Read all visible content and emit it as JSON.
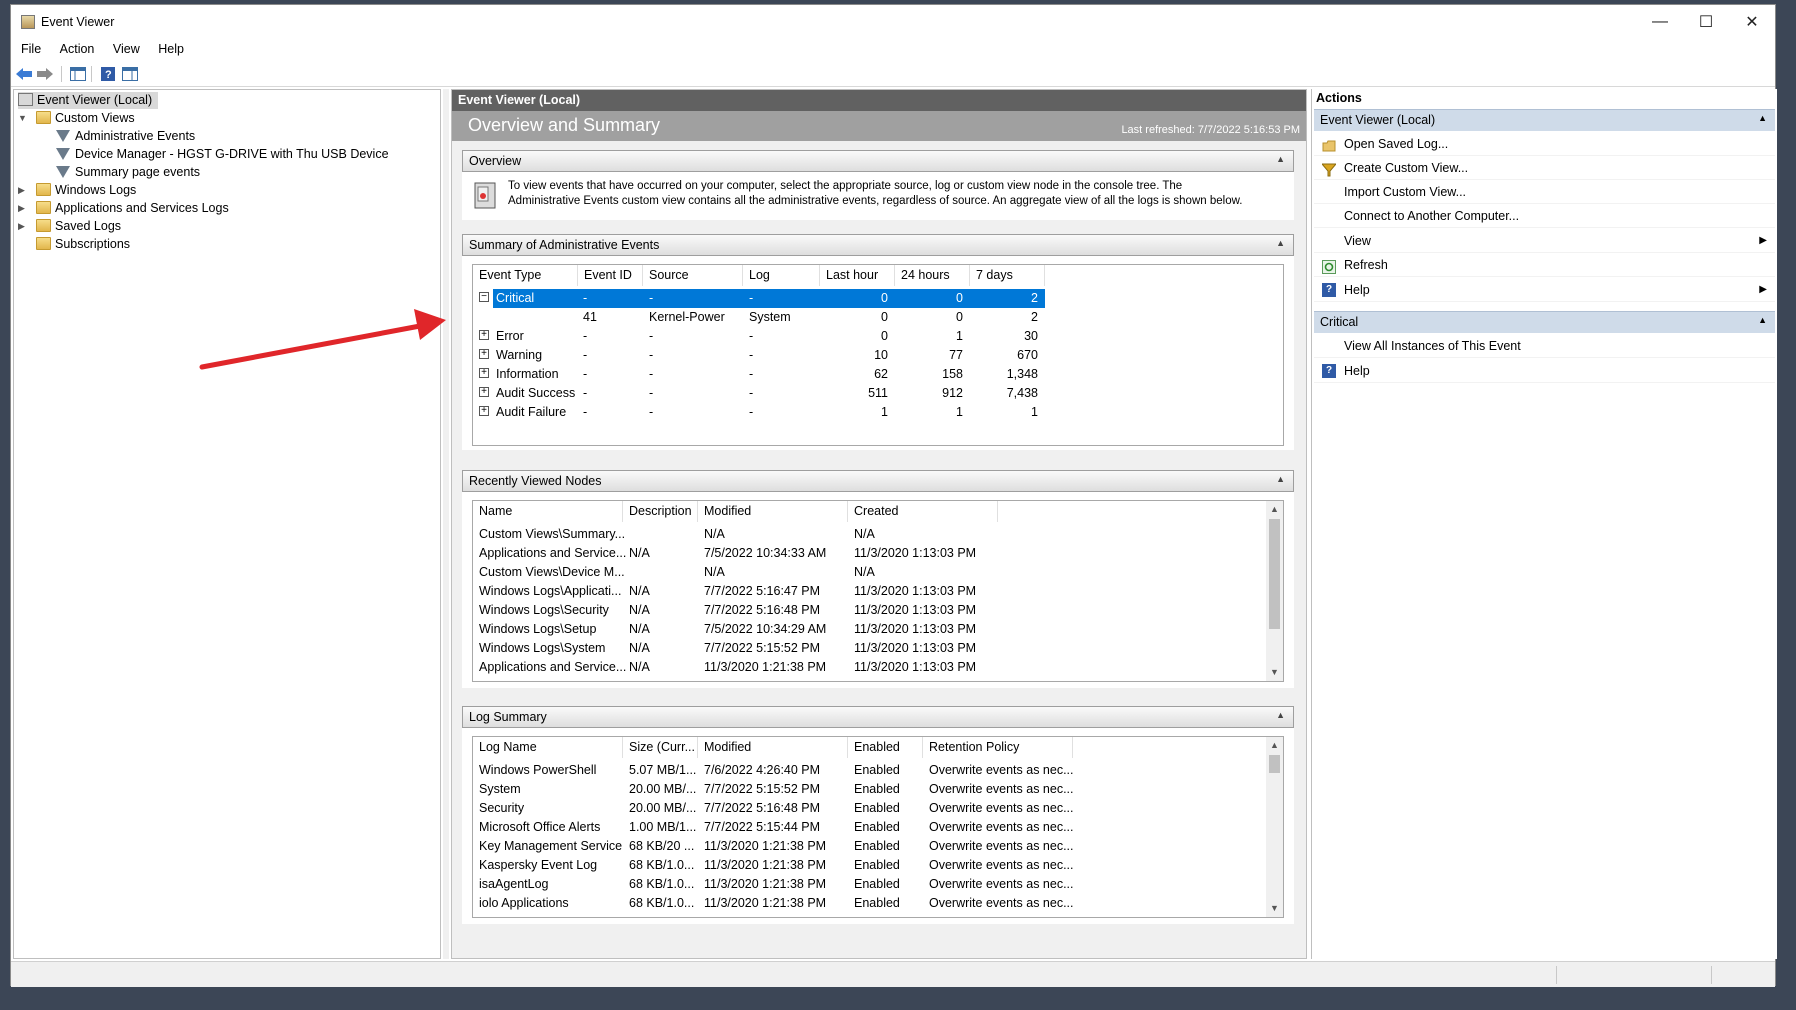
{
  "window": {
    "title": "Event Viewer",
    "minimize": "—",
    "maximize": "☐",
    "close": "✕"
  },
  "menu": [
    "File",
    "Action",
    "View",
    "Help"
  ],
  "toolbar_icons": [
    "back-arrow-icon",
    "forward-arrow-icon",
    "show-hide-console-tree-icon",
    "help-icon",
    "show-hide-action-pane-icon"
  ],
  "tree": {
    "root": "Event Viewer (Local)",
    "custom_views": "Custom Views",
    "custom_children": [
      "Administrative Events",
      "Device Manager - HGST G-DRIVE with Thu USB Device",
      "Summary page events"
    ],
    "windows_logs": "Windows Logs",
    "app_services_logs": "Applications and Services Logs",
    "saved_logs": "Saved Logs",
    "subscriptions": "Subscriptions"
  },
  "center": {
    "header": "Event Viewer (Local)",
    "banner_title": "Overview and Summary",
    "last_refreshed": "Last refreshed: 7/7/2022 5:16:53 PM",
    "overview": {
      "title": "Overview",
      "text_line1": "To view events that have occurred on your computer, select the appropriate source, log or custom view node in the console tree. The",
      "text_line2": "Administrative Events custom view contains all the administrative events, regardless of source. An aggregate view of all the logs is shown below."
    },
    "summary": {
      "title": "Summary of Administrative Events",
      "columns": [
        "Event Type",
        "Event ID",
        "Source",
        "Log",
        "Last hour",
        "24 hours",
        "7 days"
      ],
      "rows": [
        {
          "type": "Critical",
          "id": "-",
          "source": "-",
          "log": "-",
          "hour": "0",
          "day": "0",
          "week": "2",
          "expand": "−"
        },
        {
          "type": "",
          "id": "41",
          "source": "Kernel-Power",
          "log": "System",
          "hour": "0",
          "day": "0",
          "week": "2",
          "expand": ""
        },
        {
          "type": "Error",
          "id": "-",
          "source": "-",
          "log": "-",
          "hour": "0",
          "day": "1",
          "week": "30",
          "expand": "+"
        },
        {
          "type": "Warning",
          "id": "-",
          "source": "-",
          "log": "-",
          "hour": "10",
          "day": "77",
          "week": "670",
          "expand": "+"
        },
        {
          "type": "Information",
          "id": "-",
          "source": "-",
          "log": "-",
          "hour": "62",
          "day": "158",
          "week": "1,348",
          "expand": "+"
        },
        {
          "type": "Audit Success",
          "id": "-",
          "source": "-",
          "log": "-",
          "hour": "511",
          "day": "912",
          "week": "7,438",
          "expand": "+"
        },
        {
          "type": "Audit Failure",
          "id": "-",
          "source": "-",
          "log": "-",
          "hour": "1",
          "day": "1",
          "week": "1",
          "expand": "+"
        }
      ]
    },
    "recent": {
      "title": "Recently Viewed Nodes",
      "columns": [
        "Name",
        "Description",
        "Modified",
        "Created"
      ],
      "rows": [
        [
          "Custom Views\\Summary...",
          "",
          "N/A",
          "N/A"
        ],
        [
          "Applications and Service...",
          "N/A",
          "7/5/2022 10:34:33 AM",
          "11/3/2020 1:13:03 PM"
        ],
        [
          "Custom Views\\Device M...",
          "",
          "N/A",
          "N/A"
        ],
        [
          "Windows Logs\\Applicati...",
          "N/A",
          "7/7/2022 5:16:47 PM",
          "11/3/2020 1:13:03 PM"
        ],
        [
          "Windows Logs\\Security",
          "N/A",
          "7/7/2022 5:16:48 PM",
          "11/3/2020 1:13:03 PM"
        ],
        [
          "Windows Logs\\Setup",
          "N/A",
          "7/5/2022 10:34:29 AM",
          "11/3/2020 1:13:03 PM"
        ],
        [
          "Windows Logs\\System",
          "N/A",
          "7/7/2022 5:15:52 PM",
          "11/3/2020 1:13:03 PM"
        ],
        [
          "Applications and Service...",
          "N/A",
          "11/3/2020 1:21:38 PM",
          "11/3/2020 1:13:03 PM"
        ]
      ]
    },
    "log_summary": {
      "title": "Log Summary",
      "columns": [
        "Log Name",
        "Size (Curr...",
        "Modified",
        "Enabled",
        "Retention Policy"
      ],
      "rows": [
        [
          "Windows PowerShell",
          "5.07 MB/1...",
          "7/6/2022 4:26:40 PM",
          "Enabled",
          "Overwrite events as nec..."
        ],
        [
          "System",
          "20.00 MB/...",
          "7/7/2022 5:15:52 PM",
          "Enabled",
          "Overwrite events as nec..."
        ],
        [
          "Security",
          "20.00 MB/...",
          "7/7/2022 5:16:48 PM",
          "Enabled",
          "Overwrite events as nec..."
        ],
        [
          "Microsoft Office Alerts",
          "1.00 MB/1...",
          "7/7/2022 5:15:44 PM",
          "Enabled",
          "Overwrite events as nec..."
        ],
        [
          "Key Management Service",
          "68 KB/20 ...",
          "11/3/2020 1:21:38 PM",
          "Enabled",
          "Overwrite events as nec..."
        ],
        [
          "Kaspersky Event Log",
          "68 KB/1.0...",
          "11/3/2020 1:21:38 PM",
          "Enabled",
          "Overwrite events as nec..."
        ],
        [
          "isaAgentLog",
          "68 KB/1.0...",
          "11/3/2020 1:21:38 PM",
          "Enabled",
          "Overwrite events as nec..."
        ],
        [
          "iolo Applications",
          "68 KB/1.0...",
          "11/3/2020 1:21:38 PM",
          "Enabled",
          "Overwrite events as nec..."
        ]
      ]
    }
  },
  "actions": {
    "title": "Actions",
    "group1": "Event Viewer (Local)",
    "group1_items": [
      "Open Saved Log...",
      "Create Custom View...",
      "Import Custom View...",
      "Connect to Another Computer...",
      "View",
      "Refresh",
      "Help"
    ],
    "group2": "Critical",
    "group2_items": [
      "View All Instances of This Event",
      "Help"
    ]
  },
  "colors": {
    "selection": "#0078d7",
    "annotation_arrow": "#e0262a",
    "banner": "#a0a0a0",
    "header": "#616161"
  }
}
